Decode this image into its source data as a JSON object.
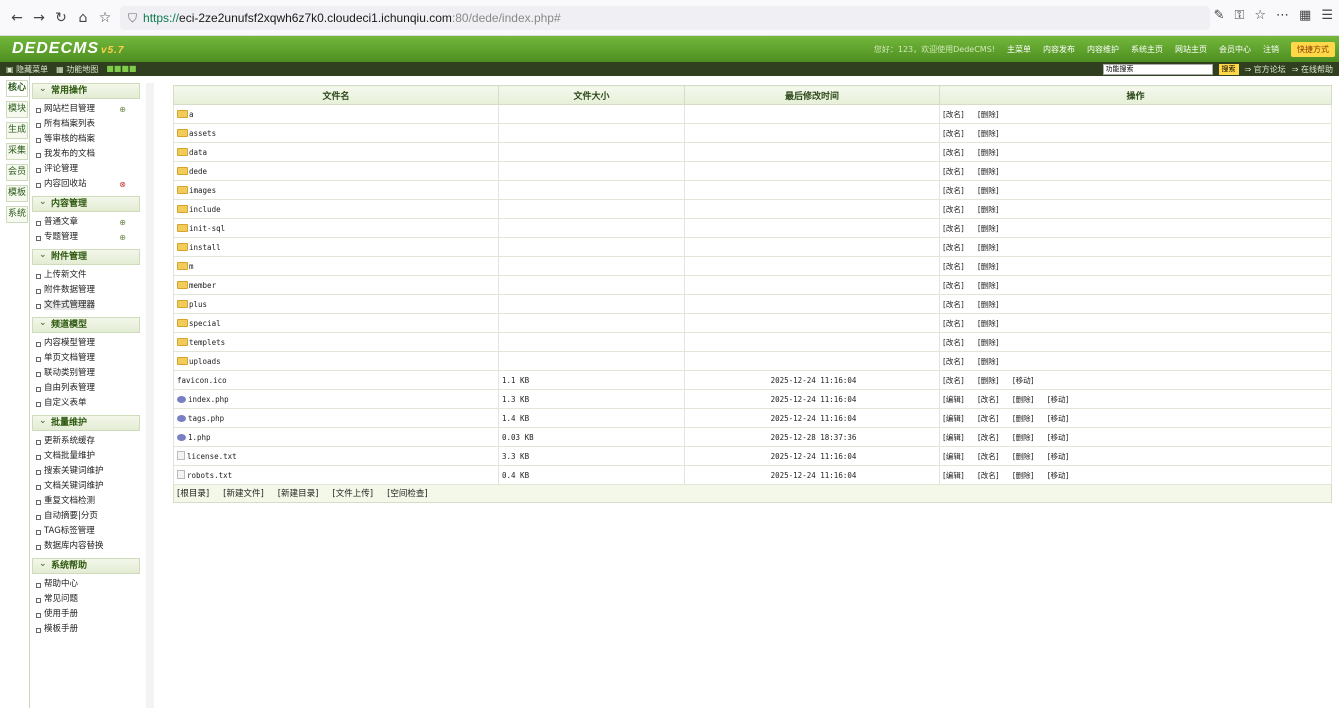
{
  "browser": {
    "url_prefix": "https://",
    "url_host": "eci-2ze2unufsf2xqwh6z7k0.cloudeci1.ichunqiu.com",
    "url_rest": ":80/dede/index.php#"
  },
  "header": {
    "logo": "DEDECMS",
    "version": "v5.7",
    "greeting": "您好：123，欢迎使用DedeCMS!",
    "nav": [
      "主菜单",
      "内容发布",
      "内容维护",
      "系统主页",
      "网站主页",
      "会员中心",
      "注销"
    ],
    "quick": "快捷方式"
  },
  "subbar": {
    "hide_menu": "隐藏菜单",
    "func_map": "功能地图",
    "search_placeholder": "功能搜索",
    "search_btn": "搜索",
    "forum": "官方论坛",
    "help": "在线帮助"
  },
  "tabs": [
    {
      "label": "核心",
      "active": true
    },
    {
      "label": "模块"
    },
    {
      "label": "生成"
    },
    {
      "label": "采集"
    },
    {
      "label": "会员"
    },
    {
      "label": "模板"
    },
    {
      "label": "系统"
    }
  ],
  "menu": [
    {
      "title": "常用操作",
      "items": [
        "网站栏目管理",
        "所有档案列表",
        "等审核的档案",
        "我发布的文档",
        "评论管理",
        "内容回收站"
      ]
    },
    {
      "title": "内容管理",
      "items": [
        "普通文章",
        "专题管理"
      ]
    },
    {
      "title": "附件管理",
      "items": [
        "上传新文件",
        "附件数据管理",
        "文件式管理器"
      ]
    },
    {
      "title": "频道模型",
      "items": [
        "内容模型管理",
        "单页文档管理",
        "联动类别管理",
        "自由列表管理",
        "自定义表单"
      ]
    },
    {
      "title": "批量维护",
      "items": [
        "更新系统缓存",
        "文档批量维护",
        "搜索关键词维护",
        "文档关键词维护",
        "重复文档检测",
        "自动摘要|分页",
        "TAG标签管理",
        "数据库内容替换"
      ]
    },
    {
      "title": "系统帮助",
      "items": [
        "帮助中心",
        "常见问题",
        "使用手册",
        "模板手册"
      ]
    }
  ],
  "table": {
    "headers": [
      "文件名",
      "文件大小",
      "最后修改时间",
      "操作"
    ],
    "rows": [
      {
        "type": "folder",
        "name": "a",
        "size": "",
        "time": "",
        "ops": [
          "[改名]",
          "[删除]"
        ]
      },
      {
        "type": "folder",
        "name": "assets",
        "size": "",
        "time": "",
        "ops": [
          "[改名]",
          "[删除]"
        ]
      },
      {
        "type": "folder",
        "name": "data",
        "size": "",
        "time": "",
        "ops": [
          "[改名]",
          "[删除]"
        ]
      },
      {
        "type": "folder",
        "name": "dede",
        "size": "",
        "time": "",
        "ops": [
          "[改名]",
          "[删除]"
        ]
      },
      {
        "type": "folder",
        "name": "images",
        "size": "",
        "time": "",
        "ops": [
          "[改名]",
          "[删除]"
        ]
      },
      {
        "type": "folder",
        "name": "include",
        "size": "",
        "time": "",
        "ops": [
          "[改名]",
          "[删除]"
        ]
      },
      {
        "type": "folder",
        "name": "init-sql",
        "size": "",
        "time": "",
        "ops": [
          "[改名]",
          "[删除]"
        ]
      },
      {
        "type": "folder",
        "name": "install",
        "size": "",
        "time": "",
        "ops": [
          "[改名]",
          "[删除]"
        ]
      },
      {
        "type": "folder",
        "name": "m",
        "size": "",
        "time": "",
        "ops": [
          "[改名]",
          "[删除]"
        ]
      },
      {
        "type": "folder",
        "name": "member",
        "size": "",
        "time": "",
        "ops": [
          "[改名]",
          "[删除]"
        ]
      },
      {
        "type": "folder",
        "name": "plus",
        "size": "",
        "time": "",
        "ops": [
          "[改名]",
          "[删除]"
        ]
      },
      {
        "type": "folder",
        "name": "special",
        "size": "",
        "time": "",
        "ops": [
          "[改名]",
          "[删除]"
        ]
      },
      {
        "type": "folder",
        "name": "templets",
        "size": "",
        "time": "",
        "ops": [
          "[改名]",
          "[删除]"
        ]
      },
      {
        "type": "folder",
        "name": "uploads",
        "size": "",
        "time": "",
        "ops": [
          "[改名]",
          "[删除]"
        ]
      },
      {
        "type": "file",
        "name": "favicon.ico",
        "size": "1.1 KB",
        "time": "2025-12-24 11:16:04",
        "ops": [
          "[改名]",
          "[删除]",
          "[移动]"
        ]
      },
      {
        "type": "php",
        "name": "index.php",
        "size": "1.3 KB",
        "time": "2025-12-24 11:16:04",
        "ops": [
          "[编辑]",
          "[改名]",
          "[删除]",
          "[移动]"
        ]
      },
      {
        "type": "php",
        "name": "tags.php",
        "size": "1.4 KB",
        "time": "2025-12-24 11:16:04",
        "ops": [
          "[编辑]",
          "[改名]",
          "[删除]",
          "[移动]"
        ]
      },
      {
        "type": "php",
        "name": "1.php",
        "size": "0.03 KB",
        "time": "2025-12-28 18:37:36",
        "ops": [
          "[编辑]",
          "[改名]",
          "[删除]",
          "[移动]"
        ]
      },
      {
        "type": "txt",
        "name": "license.txt",
        "size": "3.3 KB",
        "time": "2025-12-24 11:16:04",
        "ops": [
          "[编辑]",
          "[改名]",
          "[删除]",
          "[移动]"
        ]
      },
      {
        "type": "txt",
        "name": "robots.txt",
        "size": "0.4 KB",
        "time": "2025-12-24 11:16:04",
        "ops": [
          "[编辑]",
          "[改名]",
          "[删除]",
          "[移动]"
        ]
      }
    ],
    "footer": [
      "[根目录]",
      "[新建文件]",
      "[新建目录]",
      "[文件上传]",
      "[空间检查]"
    ]
  }
}
